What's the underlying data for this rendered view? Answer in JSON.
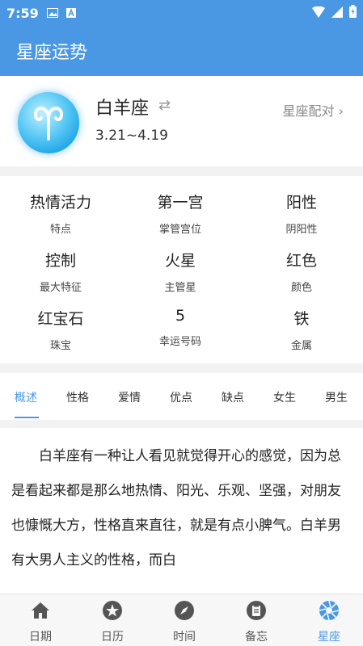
{
  "status": {
    "time": "7:59"
  },
  "app_title": "星座运势",
  "sign": {
    "name": "白羊座",
    "date_range": "3.21~4.19",
    "match_label": "星座配对",
    "swap_symbol": "⇄",
    "chevron": "›"
  },
  "info": [
    {
      "value": "热情活力",
      "key": "特点"
    },
    {
      "value": "第一宫",
      "key": "掌管宫位"
    },
    {
      "value": "阳性",
      "key": "阴阳性"
    },
    {
      "value": "控制",
      "key": "最大特征"
    },
    {
      "value": "火星",
      "key": "主管星"
    },
    {
      "value": "红色",
      "key": "颜色"
    },
    {
      "value": "红宝石",
      "key": "珠宝"
    },
    {
      "value": "5",
      "key": "幸运号码"
    },
    {
      "value": "铁",
      "key": "金属"
    }
  ],
  "tabs": [
    "概述",
    "性格",
    "爱情",
    "优点",
    "缺点",
    "女生",
    "男生"
  ],
  "active_tab": "概述",
  "content_text": "白羊座有一种让人看见就觉得开心的感觉，因为总是看起来都是那么地热情、阳光、乐观、坚强，对朋友也慷慨大方，性格直来直往，就是有点小脾气。白羊男有大男人主义的性格，而白",
  "nav": [
    {
      "label": "日期",
      "icon": "home-icon"
    },
    {
      "label": "日历",
      "icon": "star-icon"
    },
    {
      "label": "时间",
      "icon": "compass-icon"
    },
    {
      "label": "备忘",
      "icon": "clipboard-icon"
    },
    {
      "label": "星座",
      "icon": "aperture-icon"
    }
  ],
  "active_nav": "星座",
  "colors": {
    "primary": "#4a98e4",
    "accent_avatar": "#1aa2e6"
  }
}
